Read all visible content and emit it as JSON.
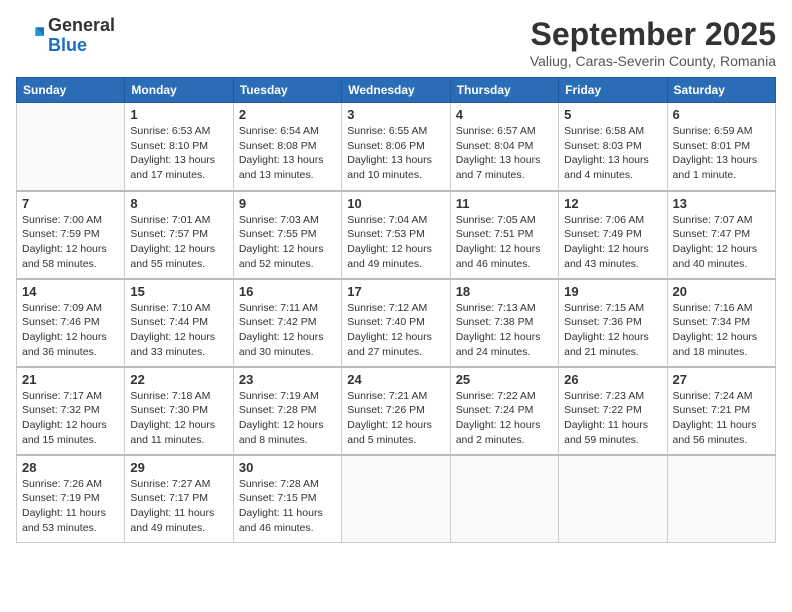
{
  "header": {
    "logo": {
      "general": "General",
      "blue": "Blue"
    },
    "title": "September 2025",
    "location": "Valiug, Caras-Severin County, Romania"
  },
  "days_of_week": [
    "Sunday",
    "Monday",
    "Tuesday",
    "Wednesday",
    "Thursday",
    "Friday",
    "Saturday"
  ],
  "weeks": [
    [
      {
        "day": "",
        "info": ""
      },
      {
        "day": "1",
        "info": "Sunrise: 6:53 AM\nSunset: 8:10 PM\nDaylight: 13 hours\nand 17 minutes."
      },
      {
        "day": "2",
        "info": "Sunrise: 6:54 AM\nSunset: 8:08 PM\nDaylight: 13 hours\nand 13 minutes."
      },
      {
        "day": "3",
        "info": "Sunrise: 6:55 AM\nSunset: 8:06 PM\nDaylight: 13 hours\nand 10 minutes."
      },
      {
        "day": "4",
        "info": "Sunrise: 6:57 AM\nSunset: 8:04 PM\nDaylight: 13 hours\nand 7 minutes."
      },
      {
        "day": "5",
        "info": "Sunrise: 6:58 AM\nSunset: 8:03 PM\nDaylight: 13 hours\nand 4 minutes."
      },
      {
        "day": "6",
        "info": "Sunrise: 6:59 AM\nSunset: 8:01 PM\nDaylight: 13 hours\nand 1 minute."
      }
    ],
    [
      {
        "day": "7",
        "info": "Sunrise: 7:00 AM\nSunset: 7:59 PM\nDaylight: 12 hours\nand 58 minutes."
      },
      {
        "day": "8",
        "info": "Sunrise: 7:01 AM\nSunset: 7:57 PM\nDaylight: 12 hours\nand 55 minutes."
      },
      {
        "day": "9",
        "info": "Sunrise: 7:03 AM\nSunset: 7:55 PM\nDaylight: 12 hours\nand 52 minutes."
      },
      {
        "day": "10",
        "info": "Sunrise: 7:04 AM\nSunset: 7:53 PM\nDaylight: 12 hours\nand 49 minutes."
      },
      {
        "day": "11",
        "info": "Sunrise: 7:05 AM\nSunset: 7:51 PM\nDaylight: 12 hours\nand 46 minutes."
      },
      {
        "day": "12",
        "info": "Sunrise: 7:06 AM\nSunset: 7:49 PM\nDaylight: 12 hours\nand 43 minutes."
      },
      {
        "day": "13",
        "info": "Sunrise: 7:07 AM\nSunset: 7:47 PM\nDaylight: 12 hours\nand 40 minutes."
      }
    ],
    [
      {
        "day": "14",
        "info": "Sunrise: 7:09 AM\nSunset: 7:46 PM\nDaylight: 12 hours\nand 36 minutes."
      },
      {
        "day": "15",
        "info": "Sunrise: 7:10 AM\nSunset: 7:44 PM\nDaylight: 12 hours\nand 33 minutes."
      },
      {
        "day": "16",
        "info": "Sunrise: 7:11 AM\nSunset: 7:42 PM\nDaylight: 12 hours\nand 30 minutes."
      },
      {
        "day": "17",
        "info": "Sunrise: 7:12 AM\nSunset: 7:40 PM\nDaylight: 12 hours\nand 27 minutes."
      },
      {
        "day": "18",
        "info": "Sunrise: 7:13 AM\nSunset: 7:38 PM\nDaylight: 12 hours\nand 24 minutes."
      },
      {
        "day": "19",
        "info": "Sunrise: 7:15 AM\nSunset: 7:36 PM\nDaylight: 12 hours\nand 21 minutes."
      },
      {
        "day": "20",
        "info": "Sunrise: 7:16 AM\nSunset: 7:34 PM\nDaylight: 12 hours\nand 18 minutes."
      }
    ],
    [
      {
        "day": "21",
        "info": "Sunrise: 7:17 AM\nSunset: 7:32 PM\nDaylight: 12 hours\nand 15 minutes."
      },
      {
        "day": "22",
        "info": "Sunrise: 7:18 AM\nSunset: 7:30 PM\nDaylight: 12 hours\nand 11 minutes."
      },
      {
        "day": "23",
        "info": "Sunrise: 7:19 AM\nSunset: 7:28 PM\nDaylight: 12 hours\nand 8 minutes."
      },
      {
        "day": "24",
        "info": "Sunrise: 7:21 AM\nSunset: 7:26 PM\nDaylight: 12 hours\nand 5 minutes."
      },
      {
        "day": "25",
        "info": "Sunrise: 7:22 AM\nSunset: 7:24 PM\nDaylight: 12 hours\nand 2 minutes."
      },
      {
        "day": "26",
        "info": "Sunrise: 7:23 AM\nSunset: 7:22 PM\nDaylight: 11 hours\nand 59 minutes."
      },
      {
        "day": "27",
        "info": "Sunrise: 7:24 AM\nSunset: 7:21 PM\nDaylight: 11 hours\nand 56 minutes."
      }
    ],
    [
      {
        "day": "28",
        "info": "Sunrise: 7:26 AM\nSunset: 7:19 PM\nDaylight: 11 hours\nand 53 minutes."
      },
      {
        "day": "29",
        "info": "Sunrise: 7:27 AM\nSunset: 7:17 PM\nDaylight: 11 hours\nand 49 minutes."
      },
      {
        "day": "30",
        "info": "Sunrise: 7:28 AM\nSunset: 7:15 PM\nDaylight: 11 hours\nand 46 minutes."
      },
      {
        "day": "",
        "info": ""
      },
      {
        "day": "",
        "info": ""
      },
      {
        "day": "",
        "info": ""
      },
      {
        "day": "",
        "info": ""
      }
    ]
  ]
}
